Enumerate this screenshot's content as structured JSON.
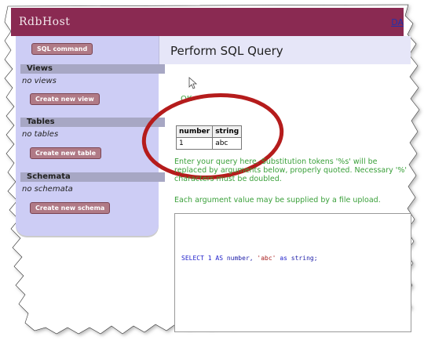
{
  "app": {
    "logo": "RdbHost",
    "top_link": "DA"
  },
  "sidebar": {
    "sql_command_label": "SQL command",
    "sections": [
      {
        "heading": "Views",
        "empty_text": "no views",
        "button_label": "Create new view"
      },
      {
        "heading": "Tables",
        "empty_text": "no tables",
        "button_label": "Create new table"
      },
      {
        "heading": "Schemata",
        "empty_text": "no schemata",
        "button_label": "Create new schema"
      }
    ]
  },
  "main": {
    "title": "Perform SQL Query",
    "status": "OK",
    "result": {
      "columns": [
        "number",
        "string"
      ],
      "rows": [
        [
          "1",
          "abc"
        ]
      ]
    },
    "instructions": "Enter your query here. Substitution tokens '%s' will be replaced by arguments below, properly quoted. Necessary '%' characters must be doubled.",
    "upload_note": "Each argument value may be supplied by a file upload.",
    "query": {
      "kw_select": "SELECT",
      "num": "1",
      "kw_as1": "AS",
      "ident1": "number,",
      "str": "'abc'",
      "kw_as2": "as",
      "ident2": "string;"
    }
  },
  "colors": {
    "header_bg": "#8a2a52",
    "sidebar_bg": "#cdcdf5",
    "section_head_bg": "#a7a7c4",
    "button_bg": "#b07a86",
    "status_green": "#3aa03a",
    "annotation_red": "#b51c1c"
  },
  "icons": {
    "cursor": "mouse-pointer-icon"
  }
}
